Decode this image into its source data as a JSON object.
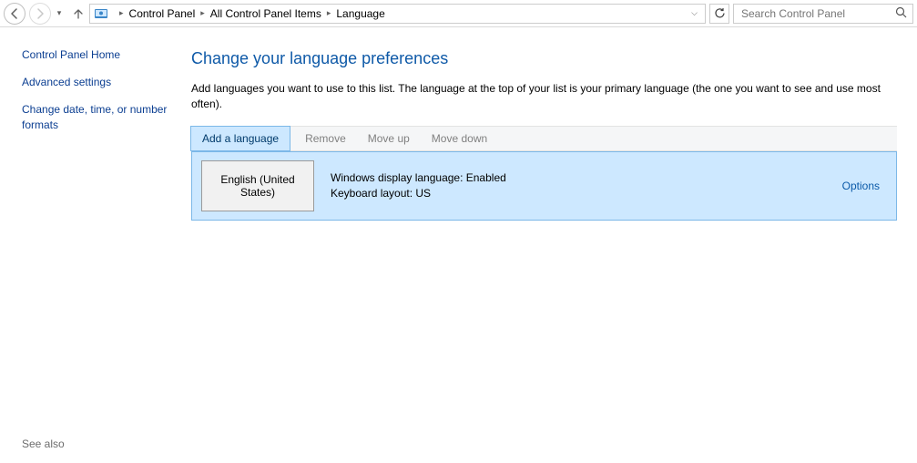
{
  "breadcrumb": {
    "items": [
      "Control Panel",
      "All Control Panel Items",
      "Language"
    ]
  },
  "search": {
    "placeholder": "Search Control Panel"
  },
  "sidebar": {
    "links": {
      "home": "Control Panel Home",
      "advanced": "Advanced settings",
      "datetime": "Change date, time, or number formats"
    },
    "see_also": "See also"
  },
  "main": {
    "title": "Change your language preferences",
    "description": "Add languages you want to use to this list. The language at the top of your list is your primary language (the one you want to see and use most often).",
    "toolbar": {
      "add": "Add a language",
      "remove": "Remove",
      "moveup": "Move up",
      "movedown": "Move down"
    },
    "lang": {
      "name": "English (United States)",
      "display_line": "Windows display language: Enabled",
      "keyboard_line": "Keyboard layout: US",
      "options": "Options"
    }
  }
}
